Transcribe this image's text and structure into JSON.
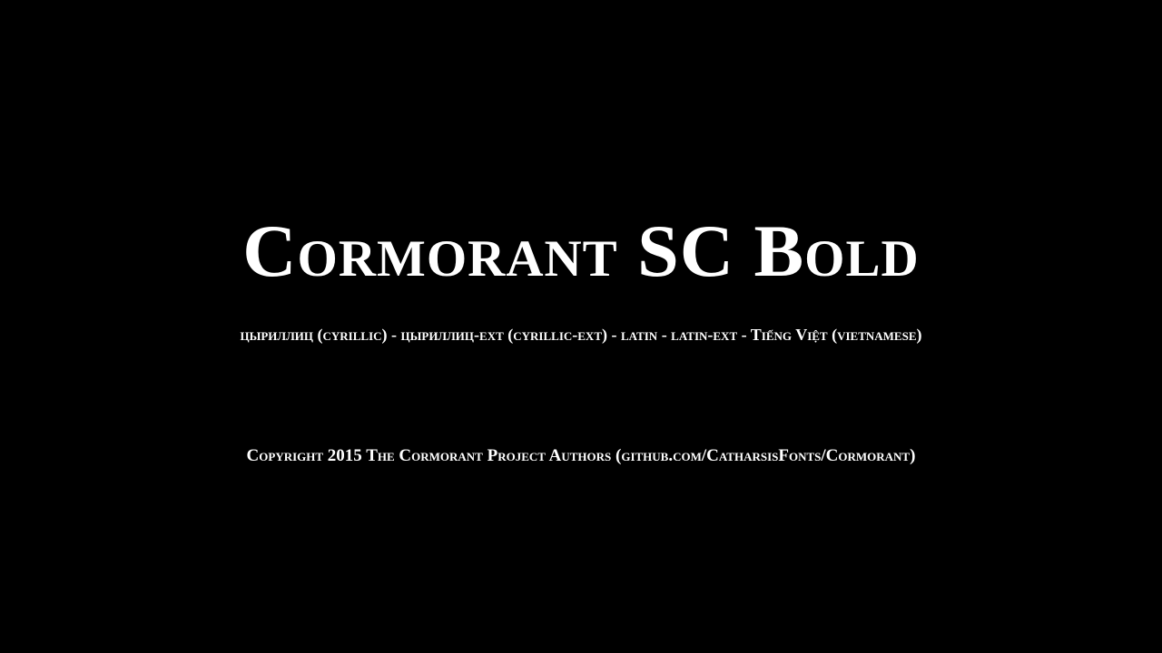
{
  "font_specimen": {
    "title": "Cormorant SC Bold",
    "subsets_line": "цыриллиц (cyrillic) - цыриллиц-ext (cyrillic-ext) - latin - latin-ext - Tiếng Việt (vietnamese)",
    "copyright": "Copyright 2015 The Cormorant Project Authors (github.com/CatharsisFonts/Cormorant)"
  },
  "colors": {
    "background": "#000000",
    "text": "#ffffff"
  }
}
